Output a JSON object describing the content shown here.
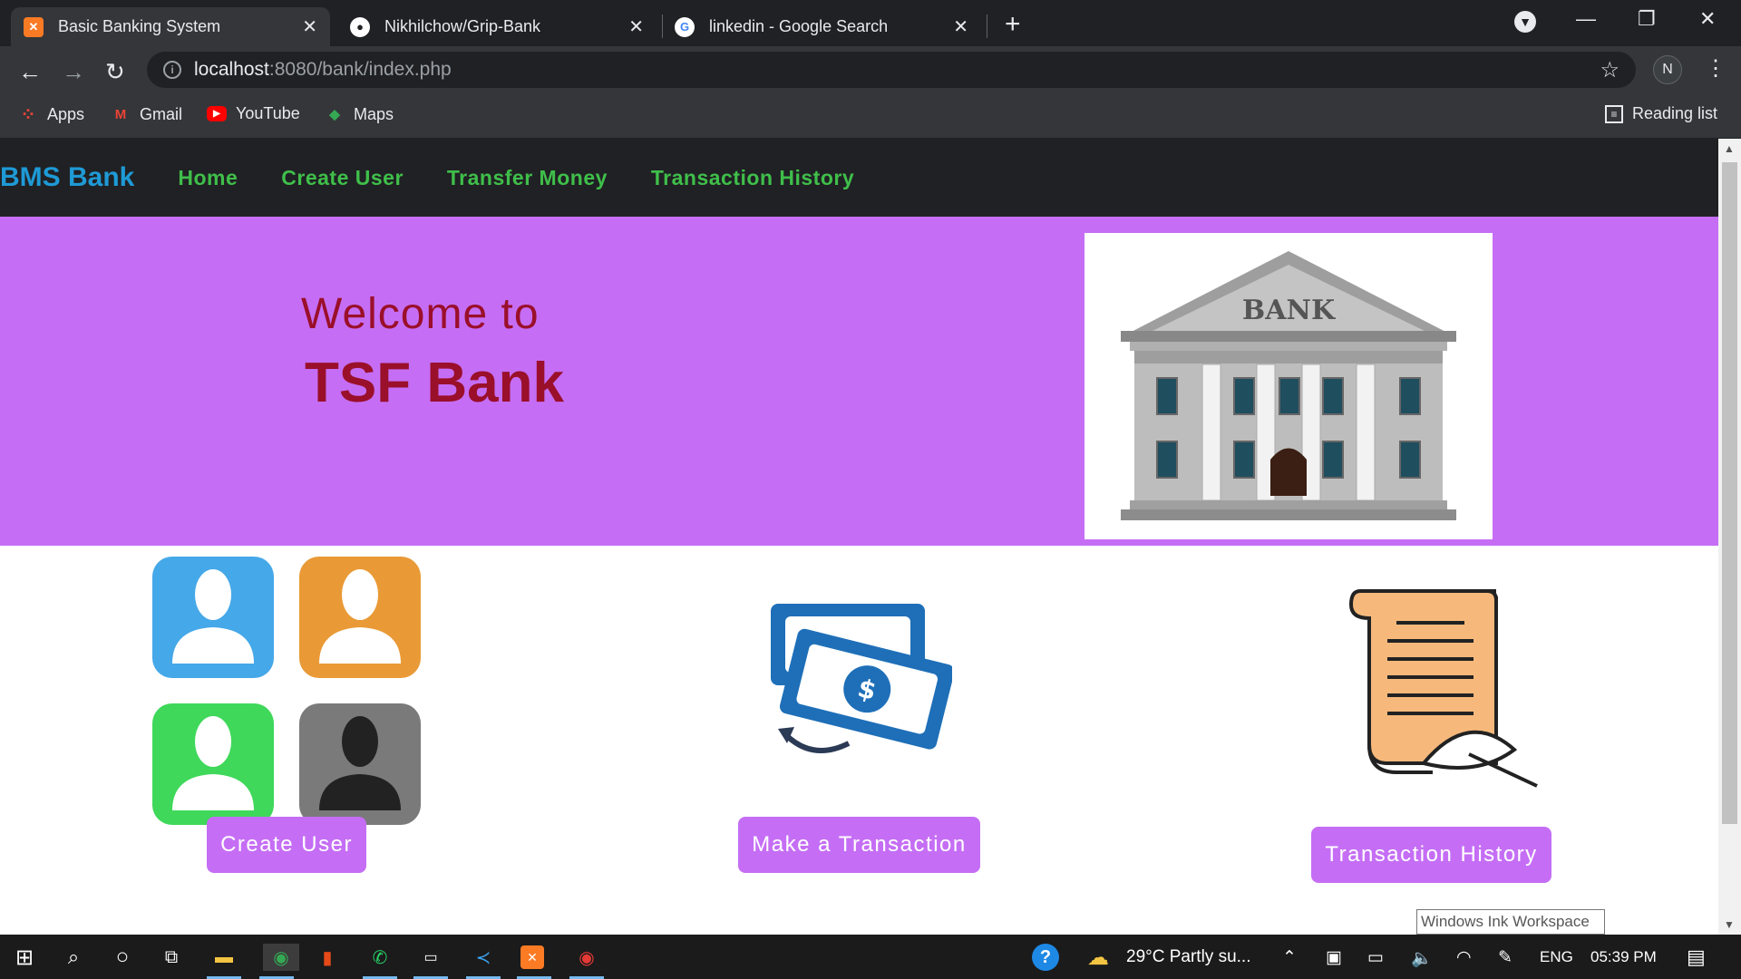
{
  "browser": {
    "tabs": [
      {
        "title": "Basic Banking System",
        "icon": "xampp-favicon-icon",
        "active": true
      },
      {
        "title": "Nikhilchow/Grip-Bank",
        "icon": "github-favicon-icon",
        "active": false
      },
      {
        "title": "linkedin - Google Search",
        "icon": "google-favicon-icon",
        "active": false
      }
    ],
    "url_host": "localhost",
    "url_rest": ":8080/bank/index.php",
    "profile_initial": "N",
    "bookmarks": [
      "Apps",
      "Gmail",
      "YouTube",
      "Maps"
    ],
    "reading_list": "Reading list"
  },
  "nav": {
    "brand": "BMS Bank",
    "links": [
      "Home",
      "Create User",
      "Transfer Money",
      "Transaction History"
    ]
  },
  "hero": {
    "welcome": "Welcome to",
    "bank_name": "TSF Bank",
    "image_sign": "BANK"
  },
  "features": [
    {
      "button": "Create User",
      "icon": "users-icon"
    },
    {
      "button": "Make a Transaction",
      "icon": "money-transfer-icon"
    },
    {
      "button": "Transaction History",
      "icon": "scroll-quill-icon"
    }
  ],
  "tooltip": "Windows Ink Workspace",
  "taskbar": {
    "weather": "29°C  Partly su...",
    "language": "ENG",
    "time": "05:39 PM"
  },
  "colors": {
    "hero_bg": "#c56ef5",
    "navbar_bg": "#202124",
    "brand": "#1e9ad6",
    "nav_link": "#3fbf4a",
    "hero_text": "#9a0f2a",
    "button_bg": "#c56ef5"
  }
}
